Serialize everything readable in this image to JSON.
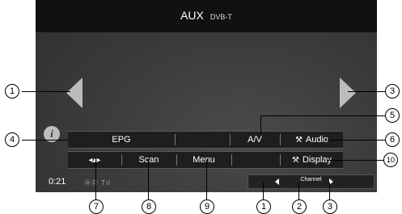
{
  "header": {
    "title": "AUX",
    "subtitle": "DVB-T"
  },
  "buttons": {
    "epg": "EPG",
    "av": "A/V",
    "audio": "Audio",
    "scan": "Scan",
    "menu": "Menu",
    "display": "Display"
  },
  "status": {
    "time": "0:21",
    "icons": "ⒹⒸ Tıl"
  },
  "channel_bar": {
    "label": "Channel"
  },
  "info_button": "i",
  "callouts": [
    "1",
    "2",
    "3",
    "4",
    "5",
    "6",
    "7",
    "8",
    "9",
    "10"
  ],
  "icons": {
    "prev": "left-triangle-icon",
    "next": "right-triangle-icon",
    "audio": "wrench-icon",
    "display": "wrench-icon",
    "dpad": "directional-pad-icon",
    "info": "info-icon"
  },
  "colors": {
    "screen_bg": "#3a3a3a",
    "button_bg": "#1e1e1e",
    "arrow": "#bcbcbc"
  }
}
